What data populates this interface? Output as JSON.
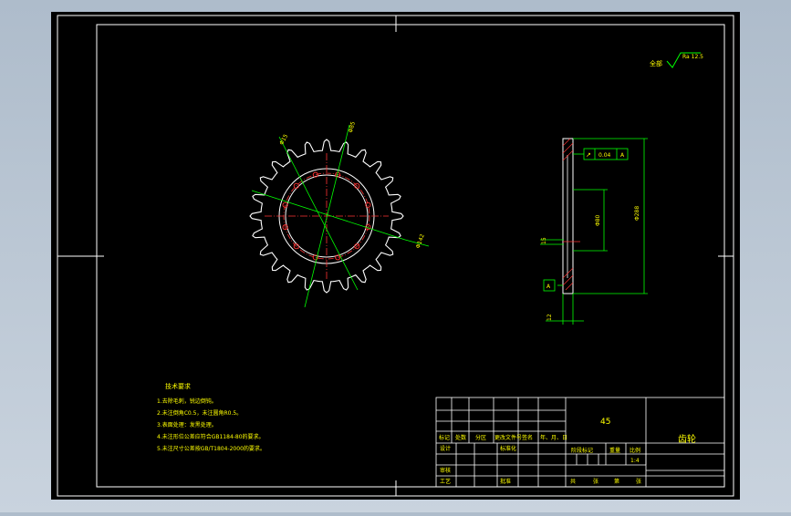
{
  "colors": {
    "background": "#000000",
    "frame": "#ffffff",
    "part_outline": "#ffffff",
    "center_line": "#ff3333",
    "dimension": "#00ff00",
    "annotation": "#ffff00",
    "window_bg": "#b4c2d0"
  },
  "roughness_note": {
    "prefix": "全部",
    "value": "Ra 12.5"
  },
  "dimensions": {
    "front_top": "Φ15",
    "front_pcd": "Φ85",
    "front_outer": "Φ142",
    "side_hub": "Φ80",
    "side_outer": "Φ288",
    "side_width": "15",
    "side_bottom": "12"
  },
  "tolerance": {
    "symbol": "↗",
    "value": "0.04",
    "datum": "A"
  },
  "datum_label": "A",
  "technical_requirements": {
    "title": "技术要求",
    "items": [
      "1.去除毛刺，锐边倒钝。",
      "2.未注倒角C0.5，未注圆角R0.5。",
      "3.表面处理：发黑处理。",
      "4.未注形位公差应符合GB1184-80的要求。",
      "5.未注尺寸公差按GB/T1804-2000的要求。"
    ]
  },
  "title_block": {
    "material": "45",
    "part_name": "齿轮",
    "scale_value": "1:4",
    "headers": {
      "mark": "标记",
      "count": "处数",
      "zone": "分区",
      "change_doc": "更改文件号",
      "signature": "签名",
      "date": "年、月、日",
      "designer": "设计",
      "standardize": "标准化",
      "stage_mark": "阶段标记",
      "weight": "重量",
      "scale": "比例",
      "checker": "审核",
      "process": "工艺",
      "approve": "批准",
      "total": "共",
      "sheet": "张",
      "number": "第",
      "sheet2": "张"
    }
  }
}
